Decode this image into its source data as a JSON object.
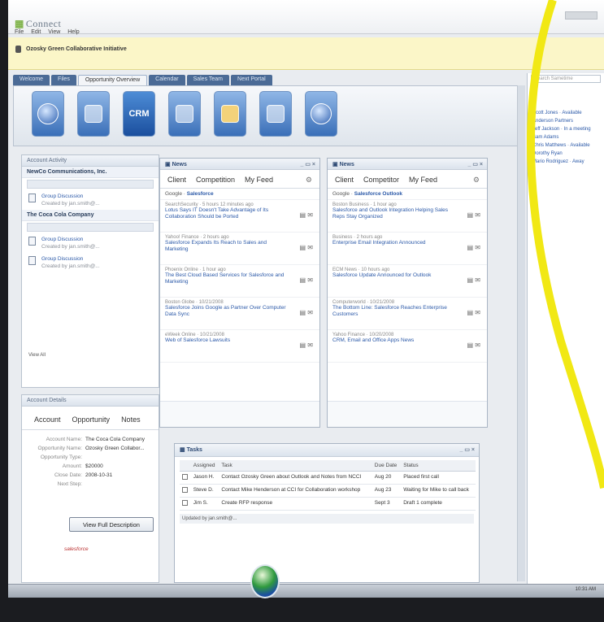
{
  "app": {
    "title": "Connect",
    "menu": [
      "File",
      "Edit",
      "View",
      "Help"
    ]
  },
  "banner": {
    "text": "Ozosky Green Collaborative Initiative"
  },
  "tabs": [
    "Welcome",
    "Files",
    "Opportunity Overview",
    "Calendar",
    "Sales Team",
    "Next Portal"
  ],
  "active_tab_index": 2,
  "toolbar_icons": [
    "round-icon",
    "document-icon",
    "crm-icon",
    "form-icon",
    "folder-icon",
    "binder-icon",
    "globe-icon"
  ],
  "crm_label": "CRM",
  "left_panel": {
    "title": "Account Activity",
    "group1": "NewCo Communications, Inc.",
    "group1_items": [
      {
        "title": "Group Discussion",
        "meta": "Created by jan.smith@..."
      }
    ],
    "group2": "The Coca Cola Company",
    "group2_items": [
      {
        "title": "Group Discussion",
        "meta": "Created by jan.smith@..."
      },
      {
        "title": "Group Discussion",
        "meta": "Created by jan.smith@..."
      }
    ],
    "view_all": "View All"
  },
  "account_panel": {
    "title": "Account Details",
    "tabs": [
      "Account",
      "Opportunity",
      "Notes"
    ],
    "fields": [
      {
        "k": "Account Name:",
        "v": "The Coca Cola Company"
      },
      {
        "k": "Opportunity Name:",
        "v": "Ozosky Green Collabor..."
      },
      {
        "k": "Opportunity Type:",
        "v": ""
      },
      {
        "k": "Amount:",
        "v": "$20000"
      },
      {
        "k": "Close Date:",
        "v": "2008-10-31"
      },
      {
        "k": "Next Step:",
        "v": ""
      }
    ],
    "button": "View Full Description",
    "stamp": "salesforce"
  },
  "news_left": {
    "title": "News",
    "tabs": [
      "Client",
      "Competition",
      "My Feed"
    ],
    "search_label": "Google",
    "search_term": "Salesforce",
    "items": [
      {
        "src": "SearchSecurity · 5 hours 12 minutes ago",
        "hl": "Lotus Says IT Doesn't Take Advantage of Its Collaboration Should be Ported"
      },
      {
        "src": "Yahoo! Finance · 2 hours ago",
        "hl": "Salesforce Expands Its Reach to Sales and Marketing"
      },
      {
        "src": "Phoenix Online · 1 hour ago",
        "hl": "The Best Cloud Based Services for Salesforce and Marketing"
      },
      {
        "src": "Boston Globe · 10/21/2008",
        "hl": "Salesforce Joins Google as Partner Over Computer Data Sync"
      },
      {
        "src": "eWeek Online · 10/21/2008",
        "hl": "Web of Salesforce Lawsuits"
      }
    ]
  },
  "news_right": {
    "title": "News",
    "tabs": [
      "Client",
      "Competitor",
      "My Feed"
    ],
    "search_label": "Google",
    "search_term": "Salesforce Outlook",
    "items": [
      {
        "src": "Boston Business · 1 hour ago",
        "hl": "Salesforce and Outlook Integration Helping Sales Reps Stay Organized"
      },
      {
        "src": "Business · 2 hours ago",
        "hl": "Enterprise Email Integration Announced"
      },
      {
        "src": "ECM News · 10 hours ago",
        "hl": "Salesforce Update Announced for Outlook"
      },
      {
        "src": "Computerworld · 10/21/2008",
        "hl": "The Bottom Line: Salesforce Reaches Enterprise Customers"
      },
      {
        "src": "Yahoo Finance · 10/20/2008",
        "hl": "CRM, Email and Office Apps News"
      }
    ]
  },
  "table": {
    "title": "Tasks",
    "headers": [
      "",
      "Assigned",
      "Task",
      "Due Date",
      "Status"
    ],
    "rows": [
      {
        "assigned": "Jason H.",
        "task": "Contact Ozosky Green about Outlook and Notes from NCCI",
        "due": "Aug 20",
        "status": "Placed first call"
      },
      {
        "assigned": "Steve D.",
        "task": "Contact Mike Henderson at CCI for Collaboration workshop",
        "due": "Aug 23",
        "status": "Waiting for Mike to call back"
      },
      {
        "assigned": "Jim S.",
        "task": "Create RFP response",
        "due": "Sept 3",
        "status": "Draft 1 complete"
      }
    ],
    "footer": "Updated by jan.smith@..."
  },
  "right_pane": {
    "search_placeholder": "Search Sametime",
    "lines": [
      "Scott Jones · Available",
      "Anderson Partners",
      "Jeff Jackson · In a meeting",
      "Sam Adams",
      "Chris Matthews · Available",
      "Dorothy Ryan",
      "Mario Rodriguez · Away"
    ]
  },
  "clock": "10:31 AM",
  "colors": {
    "accent": "#4b6b96",
    "link": "#2b59a8",
    "banner": "#fbf6c8",
    "annotation": "#f1e814"
  }
}
